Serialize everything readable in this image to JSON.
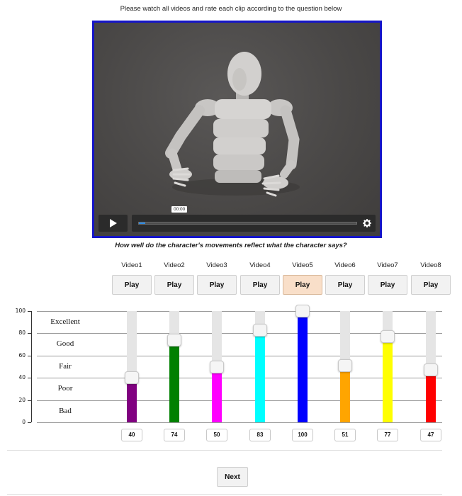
{
  "instruction": "Please watch all videos and rate each clip according to the question below",
  "player": {
    "time": "00:00",
    "progress": 0.03,
    "play_icon": "play-icon",
    "settings_icon": "gear-icon"
  },
  "question": "How well do the character's movements reflect what the character says?",
  "videos": [
    {
      "label": "Video1",
      "button": "Play",
      "rating": "40",
      "color": "#800080"
    },
    {
      "label": "Video2",
      "button": "Play",
      "rating": "74",
      "color": "#008000"
    },
    {
      "label": "Video3",
      "button": "Play",
      "rating": "50",
      "color": "#ff00ff"
    },
    {
      "label": "Video4",
      "button": "Play",
      "rating": "83",
      "color": "#00ffff"
    },
    {
      "label": "Video5",
      "button": "Play",
      "rating": "100",
      "color": "#0000ff",
      "active": true
    },
    {
      "label": "Video6",
      "button": "Play",
      "rating": "51",
      "color": "#ffa500"
    },
    {
      "label": "Video7",
      "button": "Play",
      "rating": "77",
      "color": "#ffff00"
    },
    {
      "label": "Video8",
      "button": "Play",
      "rating": "47",
      "color": "#ff0000"
    }
  ],
  "scale": {
    "ticks": [
      "100",
      "80",
      "60",
      "40",
      "20",
      "0"
    ],
    "labels": [
      "Excellent",
      "Good",
      "Fair",
      "Poor",
      "Bad"
    ]
  },
  "next_label": "Next"
}
